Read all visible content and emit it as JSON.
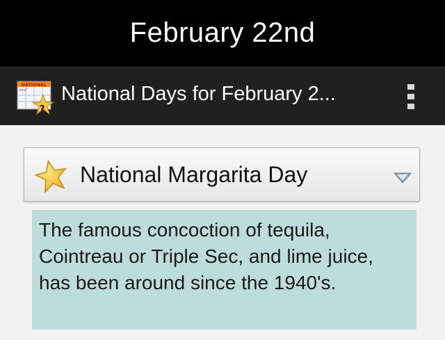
{
  "title_bar": {
    "title": "February 22nd"
  },
  "action_bar": {
    "title": "National Days for February 2...",
    "app_icon_text": "NATIONAL",
    "app_icon_subtext": "WHAT",
    "app_icon_glyph": "?",
    "app_icon": "calendar-star-question-icon",
    "overflow_icon": "overflow-menu-icon"
  },
  "spinner": {
    "selected_label": "National Margarita Day",
    "star_icon": "star-icon",
    "arrow_icon": "chevron-down-icon"
  },
  "description": {
    "text": "The famous concoction of tequila, Cointreau or Triple Sec, and lime juice, has been around since the 1940's."
  },
  "colors": {
    "title_bar_bg": "#000000",
    "action_bar_bg": "#202020",
    "content_bg": "#f2f2f2",
    "description_bg": "#bedcdc",
    "star_fill": "#f6c640"
  }
}
